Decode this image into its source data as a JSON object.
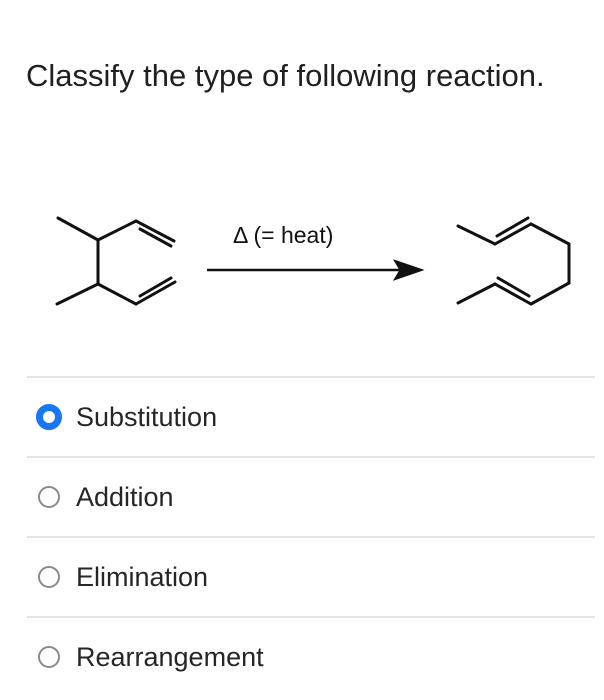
{
  "question": {
    "text": "Classify the type of following reaction."
  },
  "reaction": {
    "arrow_label": "Δ  (= heat)"
  },
  "options": [
    {
      "label": "Substitution",
      "selected": true
    },
    {
      "label": "Addition",
      "selected": false
    },
    {
      "label": "Elimination",
      "selected": false
    },
    {
      "label": "Rearrangement",
      "selected": false
    }
  ],
  "colors": {
    "selected_radio": "#1877f2",
    "unselected_radio": "#8a8a8a",
    "divider": "#e3e3e3"
  }
}
